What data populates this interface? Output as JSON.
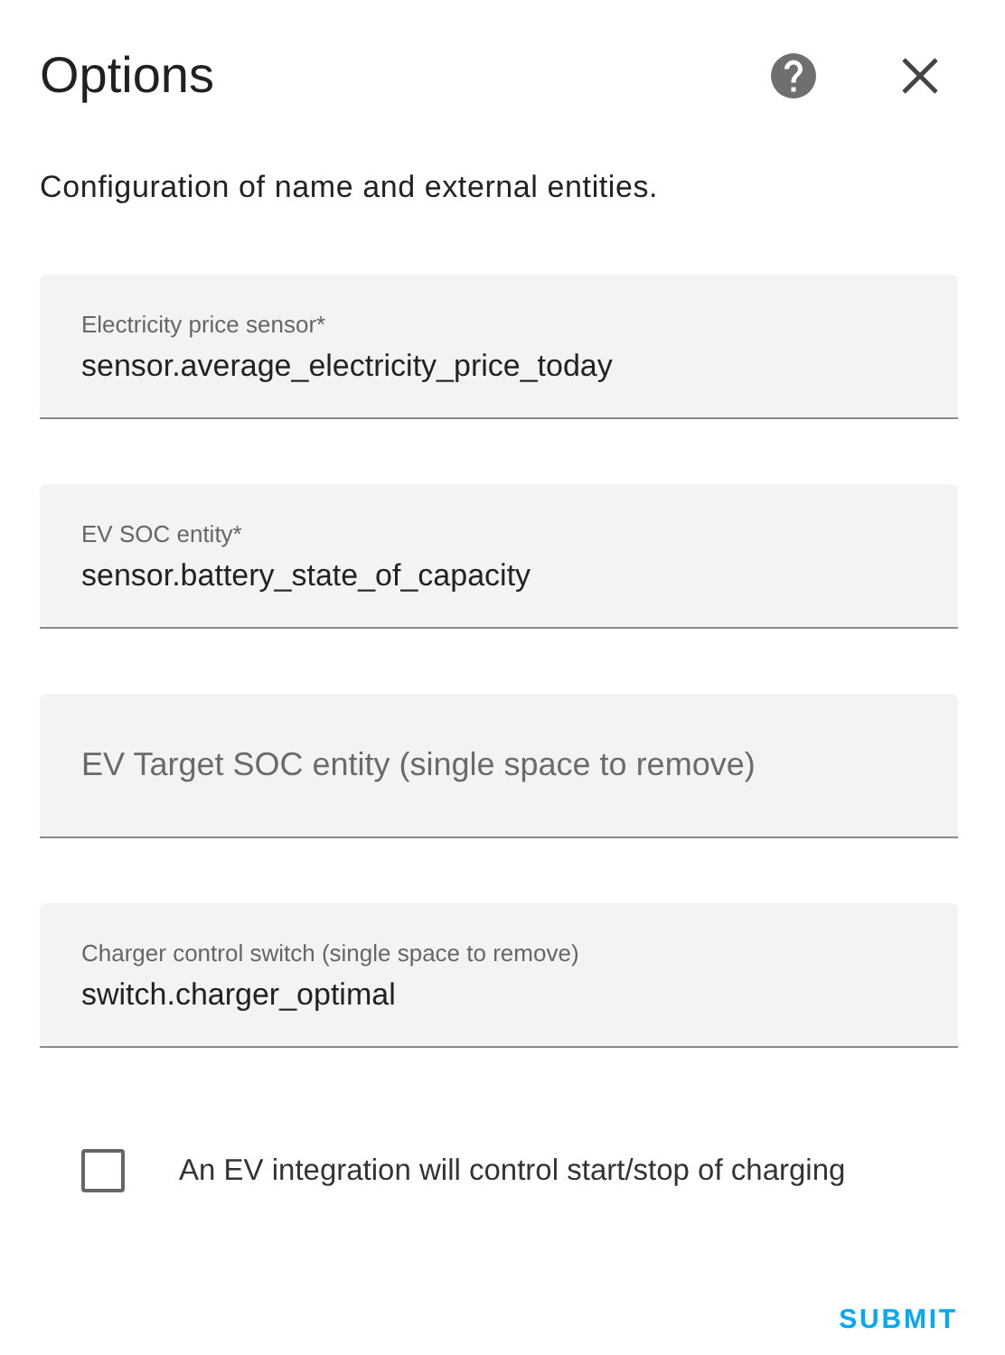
{
  "dialog": {
    "title": "Options",
    "description": "Configuration of name and external entities."
  },
  "fields": [
    {
      "label": "Electricity price sensor*",
      "value": "sensor.average_electricity_price_today"
    },
    {
      "label": "EV SOC entity*",
      "value": "sensor.battery_state_of_capacity"
    },
    {
      "label": "EV Target SOC entity (single space to remove)"
    },
    {
      "label": "Charger control switch (single space to remove)",
      "value": "switch.charger_optimal"
    }
  ],
  "checkbox": {
    "label": "An EV integration will control start/stop of charging",
    "checked": false
  },
  "buttons": [
    "SUBMIT"
  ]
}
